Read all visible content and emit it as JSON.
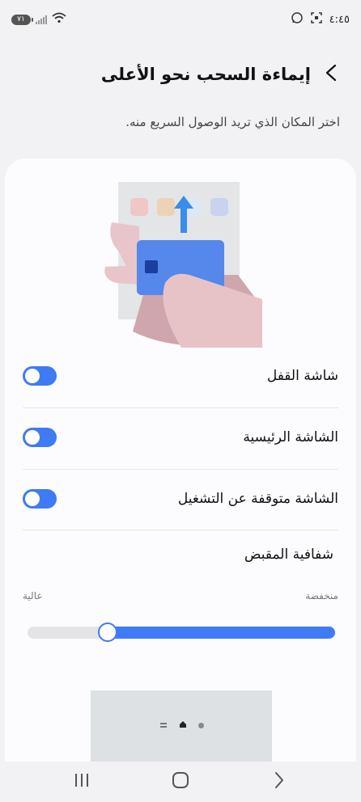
{
  "status_bar": {
    "battery": "٧١",
    "time": "٤:٤٥"
  },
  "header": {
    "title": "إيماءة السحب نحو الأعلى"
  },
  "subtitle": "اختر المكان الذي تريد الوصول السريع منه.",
  "settings": [
    {
      "label": "شاشة القفل",
      "enabled": true
    },
    {
      "label": "الشاشة الرئيسية",
      "enabled": true
    },
    {
      "label": "الشاشة متوقفة عن التشغيل",
      "enabled": true
    }
  ],
  "handle_transparency": {
    "title": "شفافية المقبض",
    "low_label": "منخفضة",
    "high_label": "عالية",
    "value_fraction": 0.26
  },
  "colors": {
    "accent": "#3e7bf4",
    "background": "#f2f2f4",
    "card": "#fcfcfe"
  },
  "icons": {
    "back": "chevron-right-icon",
    "nav_recents": "recents-icon",
    "nav_home": "home-icon",
    "nav_back": "back-icon"
  }
}
